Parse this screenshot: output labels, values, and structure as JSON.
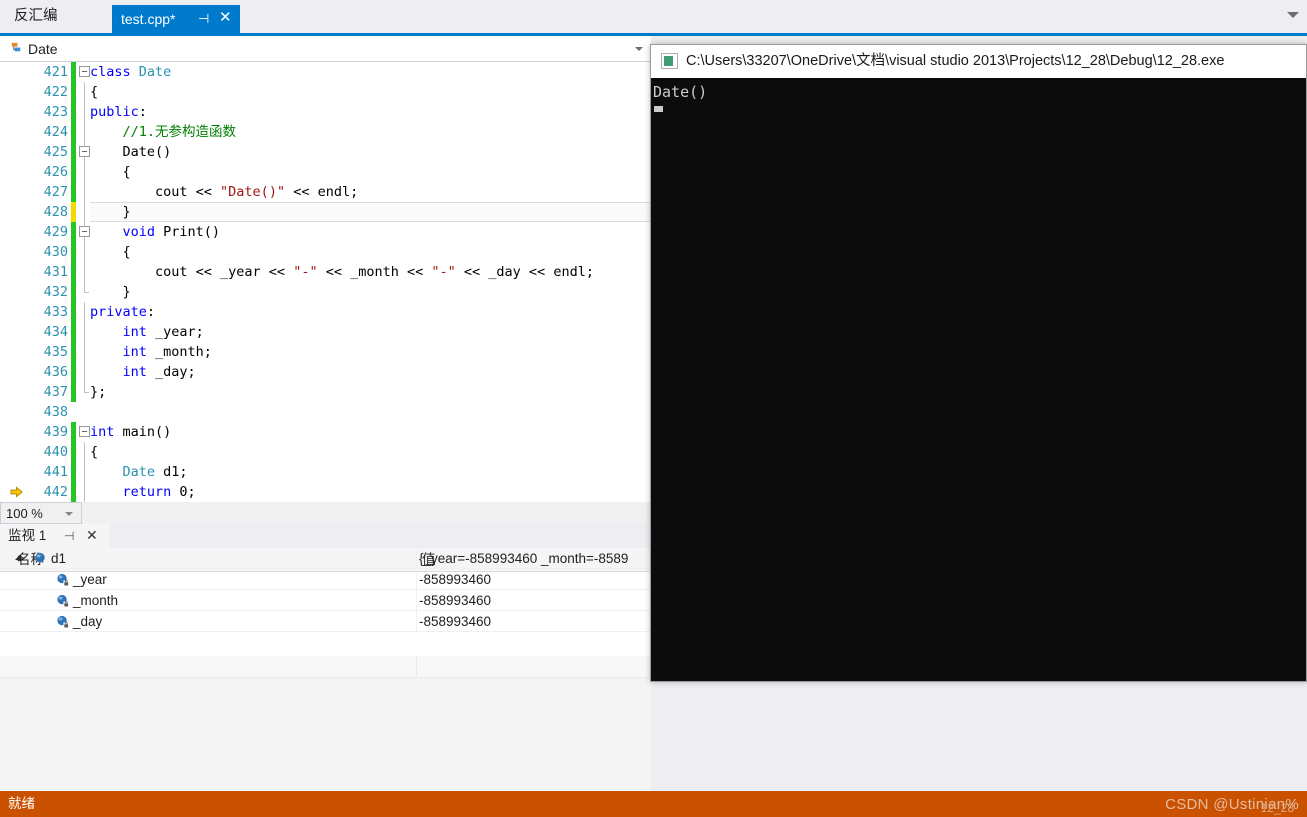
{
  "window": {
    "status_text": "就绪",
    "watermark": "CSDN @Ustinian%",
    "watermark_sub": "12_28",
    "accent_color": "#007acc",
    "status_bar_color": "#ca5100"
  },
  "tabs": {
    "inactive": {
      "label": "反汇编"
    },
    "active": {
      "label": "test.cpp*",
      "pin_icon": "⊣",
      "close_icon": "✕"
    },
    "overflow_icon": "chevron-down-icon"
  },
  "navigation_bar": {
    "icon": "class-icon",
    "scope": "Date",
    "caret_icon": "chevron-down-icon"
  },
  "editor": {
    "zoom_level": "100 %",
    "zoom_caret_icon": "chevron-down-icon",
    "execution_arrow_icon": "execution-pointer-icon",
    "lines": [
      {
        "num": "421",
        "change": "green",
        "outline": "collapse",
        "indent": 0,
        "tokens": [
          {
            "t": "class ",
            "c": "kw"
          },
          {
            "t": "Date",
            "c": "typ"
          }
        ]
      },
      {
        "num": "422",
        "change": "green",
        "outline": "none",
        "vline": true,
        "indent": 0,
        "tokens": [
          {
            "t": "{",
            "c": ""
          }
        ]
      },
      {
        "num": "423",
        "change": "green",
        "outline": "none",
        "vline": true,
        "indent": 0,
        "tokens": [
          {
            "t": "public",
            "c": "kw"
          },
          {
            "t": ":",
            "c": ""
          }
        ]
      },
      {
        "num": "424",
        "change": "green",
        "outline": "none",
        "vline": true,
        "indent": 1,
        "tokens": [
          {
            "t": "//1.无参构造函数",
            "c": "cmt"
          }
        ]
      },
      {
        "num": "425",
        "change": "green",
        "outline": "collapse",
        "vline": true,
        "indent": 1,
        "tokens": [
          {
            "t": "Date()",
            "c": ""
          }
        ]
      },
      {
        "num": "426",
        "change": "green",
        "outline": "none",
        "vline": true,
        "indent": 1,
        "tokens": [
          {
            "t": "{",
            "c": ""
          }
        ]
      },
      {
        "num": "427",
        "change": "green",
        "outline": "none",
        "vline": true,
        "indent": 2,
        "tokens": [
          {
            "t": "cout << ",
            "c": ""
          },
          {
            "t": "\"Date()\"",
            "c": "str"
          },
          {
            "t": " << endl;",
            "c": ""
          }
        ]
      },
      {
        "num": "428",
        "change": "yellow",
        "outline": "none",
        "vline": true,
        "indent": 1,
        "current": true,
        "tokens": [
          {
            "t": "}",
            "c": ""
          }
        ]
      },
      {
        "num": "429",
        "change": "green",
        "outline": "collapse",
        "vline": true,
        "indent": 1,
        "tokens": [
          {
            "t": "void ",
            "c": "kw"
          },
          {
            "t": "Print()",
            "c": ""
          }
        ]
      },
      {
        "num": "430",
        "change": "green",
        "outline": "none",
        "vline": true,
        "indent": 1,
        "tokens": [
          {
            "t": "{",
            "c": ""
          }
        ]
      },
      {
        "num": "431",
        "change": "green",
        "outline": "none",
        "vline": true,
        "indent": 2,
        "tokens": [
          {
            "t": "cout << _year << ",
            "c": ""
          },
          {
            "t": "\"-\"",
            "c": "str"
          },
          {
            "t": " << _month << ",
            "c": ""
          },
          {
            "t": "\"-\"",
            "c": "str"
          },
          {
            "t": " << _day << endl;",
            "c": ""
          }
        ]
      },
      {
        "num": "432",
        "change": "green",
        "outline": "none",
        "vline": "end",
        "indent": 1,
        "tokens": [
          {
            "t": "}",
            "c": ""
          }
        ]
      },
      {
        "num": "433",
        "change": "green",
        "outline": "none",
        "vline": true,
        "indent": 0,
        "tokens": [
          {
            "t": "private",
            "c": "kw"
          },
          {
            "t": ":",
            "c": ""
          }
        ]
      },
      {
        "num": "434",
        "change": "green",
        "outline": "none",
        "vline": true,
        "indent": 1,
        "tokens": [
          {
            "t": "int ",
            "c": "kw"
          },
          {
            "t": "_year;",
            "c": ""
          }
        ]
      },
      {
        "num": "435",
        "change": "green",
        "outline": "none",
        "vline": true,
        "indent": 1,
        "tokens": [
          {
            "t": "int ",
            "c": "kw"
          },
          {
            "t": "_month;",
            "c": ""
          }
        ]
      },
      {
        "num": "436",
        "change": "green",
        "outline": "none",
        "vline": true,
        "indent": 1,
        "tokens": [
          {
            "t": "int ",
            "c": "kw"
          },
          {
            "t": "_day;",
            "c": ""
          }
        ]
      },
      {
        "num": "437",
        "change": "green",
        "outline": "none",
        "vline": "end",
        "indent": 0,
        "tokens": [
          {
            "t": "};",
            "c": ""
          }
        ]
      },
      {
        "num": "438",
        "change": "none",
        "outline": "none",
        "indent": 0,
        "tokens": []
      },
      {
        "num": "439",
        "change": "green",
        "outline": "collapse",
        "indent": 0,
        "tokens": [
          {
            "t": "int ",
            "c": "kw"
          },
          {
            "t": "main()",
            "c": ""
          }
        ]
      },
      {
        "num": "440",
        "change": "green",
        "outline": "none",
        "vline": true,
        "indent": 0,
        "tokens": [
          {
            "t": "{",
            "c": ""
          }
        ]
      },
      {
        "num": "441",
        "change": "green",
        "outline": "none",
        "vline": true,
        "indent": 1,
        "tokens": [
          {
            "t": "Date",
            "c": "typ"
          },
          {
            "t": " d1;",
            "c": ""
          }
        ]
      },
      {
        "num": "442",
        "change": "green",
        "outline": "none",
        "vline": true,
        "indent": 1,
        "exec": true,
        "tokens": [
          {
            "t": "return ",
            "c": "kw"
          },
          {
            "t": "0;",
            "c": ""
          }
        ]
      }
    ]
  },
  "watch_panel": {
    "tab_label": "监视 1",
    "pin_icon": "⊣",
    "close_icon": "✕",
    "columns": [
      "名称",
      "值"
    ],
    "rows": [
      {
        "name": "d1",
        "value": "{_year=-858993460 _month=-8589",
        "icon": "variable-icon",
        "expandable": true,
        "depth": 0
      },
      {
        "name": "_year",
        "value": "-858993460",
        "icon": "field-private-icon",
        "expandable": false,
        "depth": 1
      },
      {
        "name": "_month",
        "value": "-858993460",
        "icon": "field-private-icon",
        "expandable": false,
        "depth": 1
      },
      {
        "name": "_day",
        "value": "-858993460",
        "icon": "field-private-icon",
        "expandable": false,
        "depth": 1
      }
    ]
  },
  "console": {
    "icon": "console-app-icon",
    "title": "C:\\Users\\33207\\OneDrive\\文档\\visual studio 2013\\Projects\\12_28\\Debug\\12_28.exe",
    "output": "Date()",
    "cursor": "block-cursor"
  }
}
